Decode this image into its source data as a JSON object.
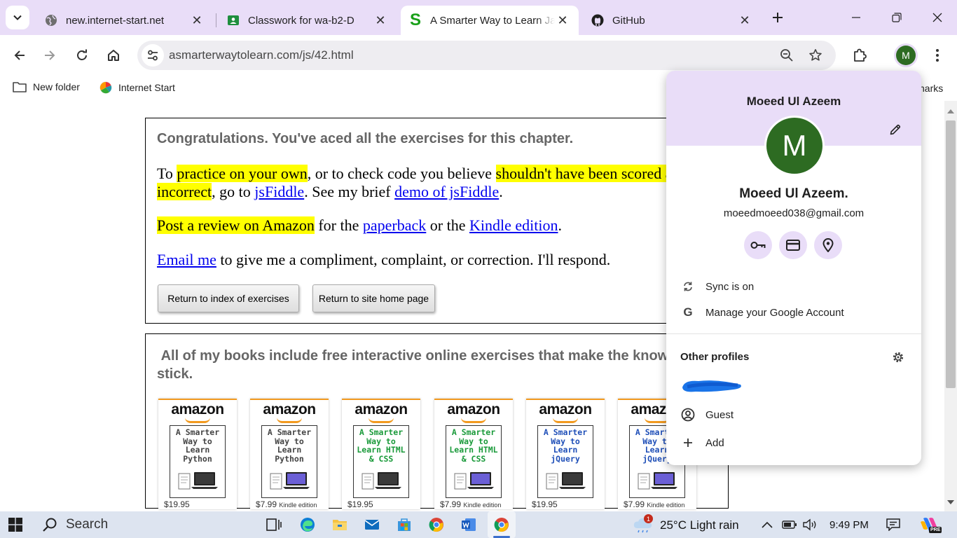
{
  "browser": {
    "tabs": [
      {
        "title": "new.internet-start.net",
        "icon": "globe-icon"
      },
      {
        "title": "Classwork for wa-b2-D",
        "icon": "google-classroom-icon"
      },
      {
        "title": "A Smarter Way to Learn JavaScript",
        "icon": "smarter-way-s-icon",
        "active": true
      },
      {
        "title": "GitHub",
        "icon": "github-icon"
      }
    ],
    "url": "asmarterwaytolearn.com/js/42.html",
    "profile_initial": "M"
  },
  "bookmarks": {
    "items": [
      {
        "label": "New folder",
        "icon": "folder-icon"
      },
      {
        "label": "Internet Start",
        "icon": "internet-start-icon"
      }
    ],
    "other_label": "narks"
  },
  "page": {
    "congrats": "Congratulations. You've aced all the exercises for this chapter.",
    "p1": {
      "to": "To ",
      "practice": "practice on your own",
      "mid": ", or to check code you believe ",
      "shouldnt": "shouldn't have been scored as incorrect",
      "goto": ", go to ",
      "jsfiddle": "jsFiddle",
      "see": ". See my brief ",
      "demo": "demo of jsFiddle",
      "end": "."
    },
    "p2": {
      "review": "Post a review on Amazon",
      "for": " for the ",
      "paperback": "paperback",
      "or": " or the ",
      "kindle": "Kindle edition",
      "end": "."
    },
    "p3": {
      "email": "Email me",
      "rest": " to give me a compliment, complaint, or correction. I'll respond."
    },
    "buttons": {
      "index": "Return to index of exercises",
      "home": "Return to site home page"
    },
    "books_heading": "All of my books include free interactive online exercises that make the knowledge stick.",
    "books": [
      {
        "brand": "amazon",
        "title": "A Smarter Way to Learn Python",
        "price": "$19.95",
        "edition": "",
        "color": "#444444"
      },
      {
        "brand": "amazon",
        "title": "A Smarter Way to Learn Python",
        "price": "$7.99",
        "edition": "Kindle edition",
        "color": "#444444"
      },
      {
        "brand": "amazon",
        "title": "A Smarter Way to Learn HTML & CSS",
        "price": "$19.95",
        "edition": "",
        "color": "#1a9a3a"
      },
      {
        "brand": "amazon",
        "title": "A Smarter Way to Learn HTML & CSS",
        "price": "$7.99",
        "edition": "Kindle edition",
        "color": "#1a9a3a"
      },
      {
        "brand": "amazon",
        "title": "A Smarter Way to Learn jQuery",
        "price": "$19.95",
        "edition": "",
        "color": "#1f4fb8"
      },
      {
        "brand": "amazon",
        "title": "A Smarter Way to Learn jQuery",
        "price": "$7.99",
        "edition": "Kindle edition",
        "color": "#1f4fb8"
      }
    ]
  },
  "profile_menu": {
    "header_name": "Moeed Ul Azeem",
    "avatar_initial": "M",
    "full_name": "Moeed Ul Azeem.",
    "email": "moeedmoeed038@gmail.com",
    "quick_icons": [
      "key-icon",
      "payment-card-icon",
      "location-pin-icon"
    ],
    "sync": "Sync is on",
    "manage": "Manage your Google Account",
    "other_profiles": "Other profiles",
    "guest": "Guest",
    "add": "Add"
  },
  "taskbar": {
    "search": "Search",
    "weather_badge": "1",
    "weather": "25°C  Light rain",
    "time": "9:49 PM",
    "copilot_badge": "PRE"
  },
  "colors": {
    "accent": "#e9ddf8",
    "avatar": "#2d6b22",
    "highlight": "#ffff00",
    "link": "#0000ee",
    "amazon_orange": "#f29a1f"
  }
}
